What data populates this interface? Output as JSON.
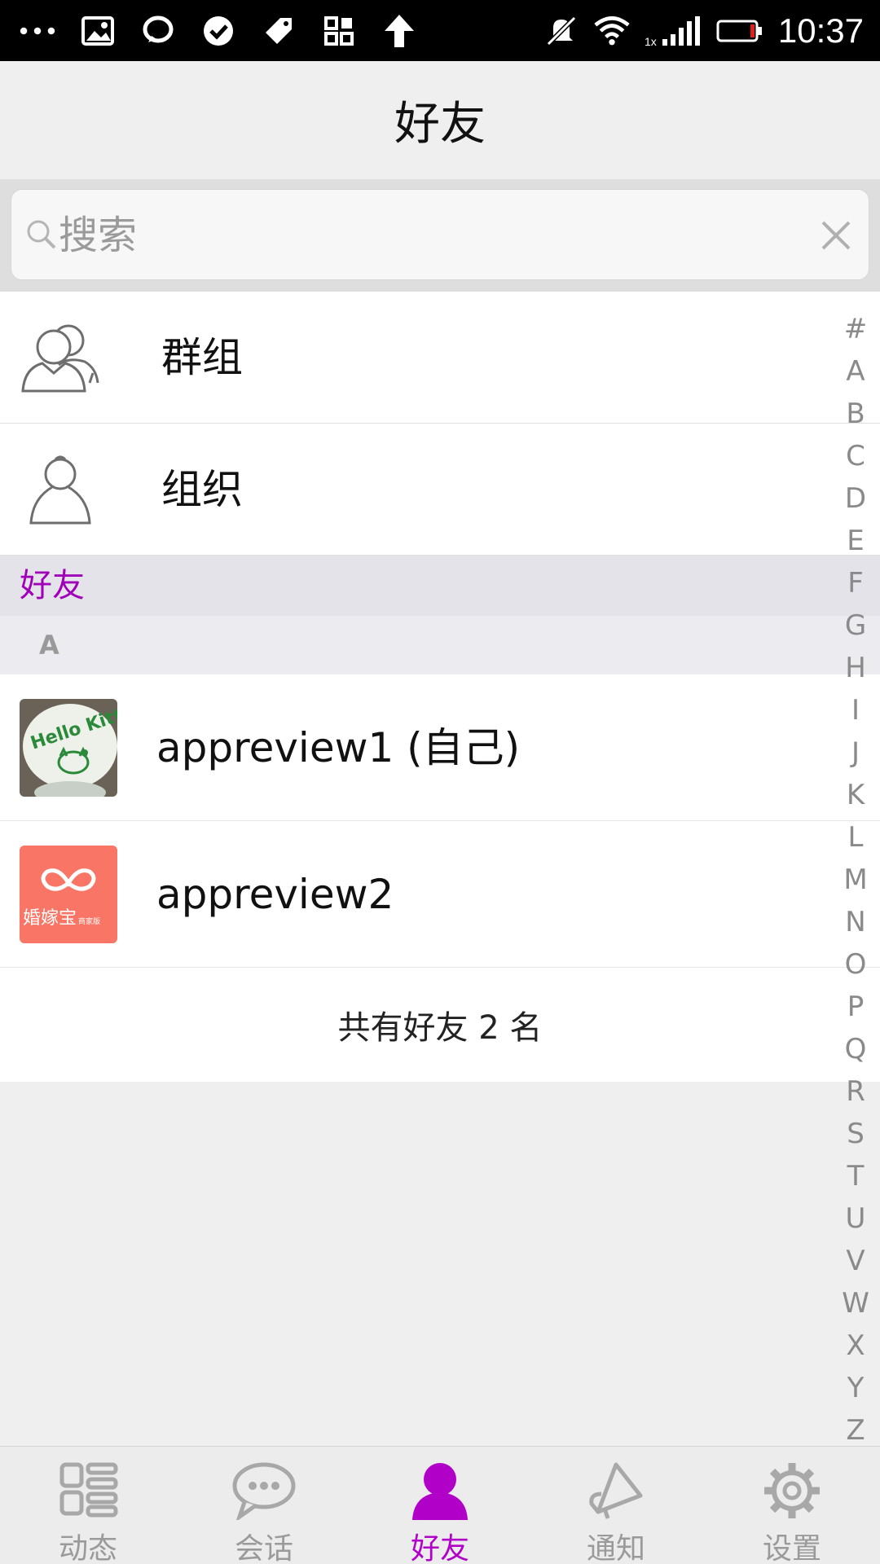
{
  "status_bar": {
    "time": "10:37",
    "signal_label": "1x"
  },
  "header": {
    "title": "好友"
  },
  "search": {
    "placeholder": "搜索"
  },
  "entries": [
    {
      "label": "群组",
      "icon": "group-icon"
    },
    {
      "label": "组织",
      "icon": "person-icon"
    }
  ],
  "section": {
    "label": "好友",
    "letter": "A"
  },
  "friends": [
    {
      "name": "appreview1 (自己)",
      "avatar": "hello-kitty-avatar"
    },
    {
      "name": "appreview2",
      "avatar": "brand-avatar",
      "avatar_text": "婚嫁宝",
      "avatar_subtext": "商家版"
    }
  ],
  "footer": {
    "count_text": "共有好友 2 名"
  },
  "index_letters": [
    "#",
    "A",
    "B",
    "C",
    "D",
    "E",
    "F",
    "G",
    "H",
    "I",
    "J",
    "K",
    "L",
    "M",
    "N",
    "O",
    "P",
    "Q",
    "R",
    "S",
    "T",
    "U",
    "V",
    "W",
    "X",
    "Y",
    "Z"
  ],
  "bottom_nav": [
    {
      "label": "动态",
      "icon": "feed-grid-icon"
    },
    {
      "label": "会话",
      "icon": "chat-bubble-icon"
    },
    {
      "label": "好友",
      "icon": "friend-person-icon",
      "active": true
    },
    {
      "label": "通知",
      "icon": "megaphone-icon"
    },
    {
      "label": "设置",
      "icon": "gear-icon"
    }
  ],
  "colors": {
    "accent": "#b100c8",
    "section_text": "#a000b8",
    "avatar_brand_bg": "#f97565"
  }
}
